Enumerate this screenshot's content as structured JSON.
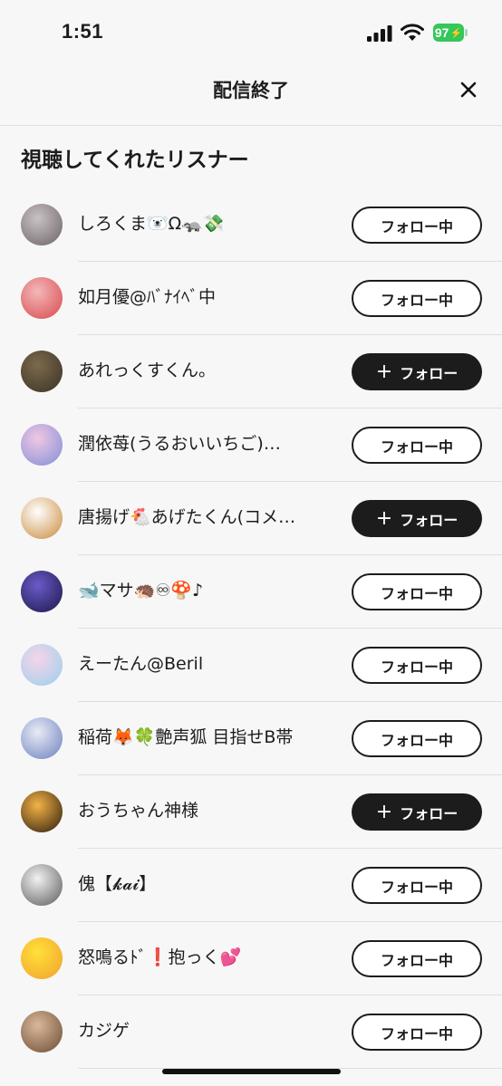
{
  "status_bar": {
    "time": "1:51",
    "battery": "97"
  },
  "header": {
    "title": "配信終了",
    "close_icon": "close-icon"
  },
  "section": {
    "title": "視聴してくれたリスナー"
  },
  "listeners": [
    {
      "name": "しろくま🐻‍❄️Ω🦡💸",
      "button": "フォロー中",
      "following": true,
      "avatar_colors": [
        "#c9c2c4",
        "#6b6266"
      ]
    },
    {
      "name": "如月優@ﾊﾞﾅｲﾍﾞ中",
      "button": "フォロー中",
      "following": true,
      "avatar_colors": [
        "#f3b8b8",
        "#d8484e"
      ]
    },
    {
      "name": "あれっくすくん。",
      "button": "フォロー",
      "following": false,
      "avatar_colors": [
        "#7b6a4c",
        "#3a3226"
      ]
    },
    {
      "name": "潤依苺(うるおいいちご)…",
      "button": "フォロー中",
      "following": true,
      "avatar_colors": [
        "#f1c7e3",
        "#7f8fd8"
      ]
    },
    {
      "name": "唐揚げ🐔あげたくん(コメ…",
      "button": "フォロー",
      "following": false,
      "avatar_colors": [
        "#ffffff",
        "#c98a3a"
      ]
    },
    {
      "name": "🐋マサ🦔♾🍄♪",
      "button": "フォロー中",
      "following": true,
      "avatar_colors": [
        "#6a5bc9",
        "#1b1747"
      ]
    },
    {
      "name": "えーたん@Beril",
      "button": "フォロー中",
      "following": true,
      "avatar_colors": [
        "#f6d4ea",
        "#9ad0ec"
      ]
    },
    {
      "name": "稲荷🦊🍀艶声狐 目指せB帯",
      "button": "フォロー中",
      "following": true,
      "avatar_colors": [
        "#e9ecf4",
        "#6b7fbf"
      ]
    },
    {
      "name": "おうちゃん神様",
      "button": "フォロー",
      "following": false,
      "avatar_colors": [
        "#f4b347",
        "#2a1a0c"
      ]
    },
    {
      "name": "傀【𝓴𝓪𝓲】",
      "button": "フォロー中",
      "following": true,
      "avatar_colors": [
        "#f2f2f2",
        "#5a5a5a"
      ]
    },
    {
      "name": "怒鳴るﾄﾞ❗️抱っく💕",
      "button": "フォロー中",
      "following": true,
      "avatar_colors": [
        "#ffe03a",
        "#f2a02d"
      ]
    },
    {
      "name": "カジゲ",
      "button": "フォロー中",
      "following": true,
      "avatar_colors": [
        "#d9b89a",
        "#6b4b33"
      ]
    }
  ],
  "colors": {
    "accent_dark": "#1c1c1c",
    "battery_green": "#34c759",
    "background": "#f7f7f7"
  }
}
